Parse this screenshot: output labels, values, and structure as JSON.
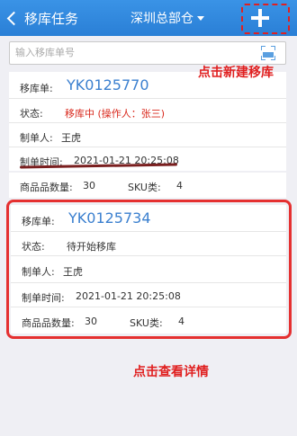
{
  "header": {
    "back_label": "移库任务",
    "warehouse": "深圳总部仓",
    "colors": {
      "bar": "#2e86de",
      "accent": "#e02020"
    }
  },
  "search": {
    "placeholder": "输入移库单号",
    "scan_icon": "scan-icon"
  },
  "annotations": {
    "add": "点击新建移库",
    "detail": "点击查看详情"
  },
  "cards": [
    {
      "order_label": "移库单:",
      "order_no": "YK0125770",
      "status_label": "状态:",
      "status_value": "移库中 (操作人：张三)",
      "creator_label": "制单人:",
      "creator": "王虎",
      "time_label": "制单时间:",
      "time": "2021-01-21 20:25:08"
    },
    {
      "order_label": "移库单:",
      "order_no": "YK0125734",
      "status_label": "状态:",
      "status_value": "待开始移库",
      "creator_label": "制单人:",
      "creator": "王虎",
      "time_label": "制单时间:",
      "time": "2021-01-21 20:25:08",
      "qty_label": "商品品数量:",
      "qty": "30",
      "sku_label": "SKU类:",
      "sku": "4"
    }
  ],
  "card1_footer": {
    "qty_label": "商品品数量:",
    "qty": "30",
    "sku_label": "SKU类:",
    "sku": "4"
  }
}
